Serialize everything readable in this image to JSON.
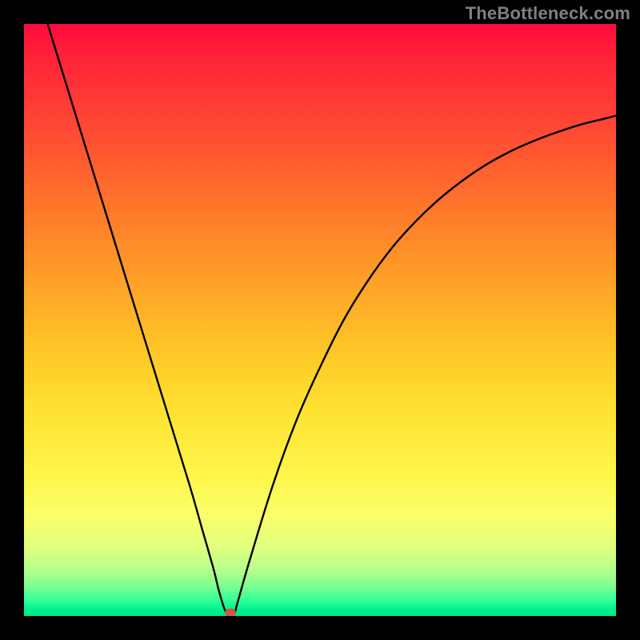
{
  "watermark": "TheBottleneck.com",
  "colors": {
    "page_bg": "#000000",
    "curve": "#000000",
    "marker": "#cc5a4a",
    "gradient_top": "#ff0a3c",
    "gradient_bottom": "#00e88c"
  },
  "chart_data": {
    "type": "line",
    "title": "",
    "xlabel": "",
    "ylabel": "",
    "xlim": [
      0,
      100
    ],
    "ylim": [
      0,
      100
    ],
    "x": [
      4,
      8,
      12,
      16,
      20,
      24,
      28,
      30,
      32,
      33,
      34.2,
      35.5,
      36,
      38,
      42,
      46,
      50,
      54,
      58,
      62,
      66,
      70,
      74,
      78,
      82,
      86,
      90,
      94,
      98,
      100
    ],
    "y": [
      100,
      87,
      74,
      61,
      48,
      35,
      22,
      15,
      8,
      4,
      0.5,
      0.5,
      2,
      9,
      22,
      33,
      42,
      50,
      56.5,
      62,
      66.5,
      70.3,
      73.5,
      76.2,
      78.4,
      80.2,
      81.7,
      83,
      84,
      84.5
    ],
    "marker": {
      "x": 34.8,
      "y": 0.5
    },
    "annotations": []
  }
}
